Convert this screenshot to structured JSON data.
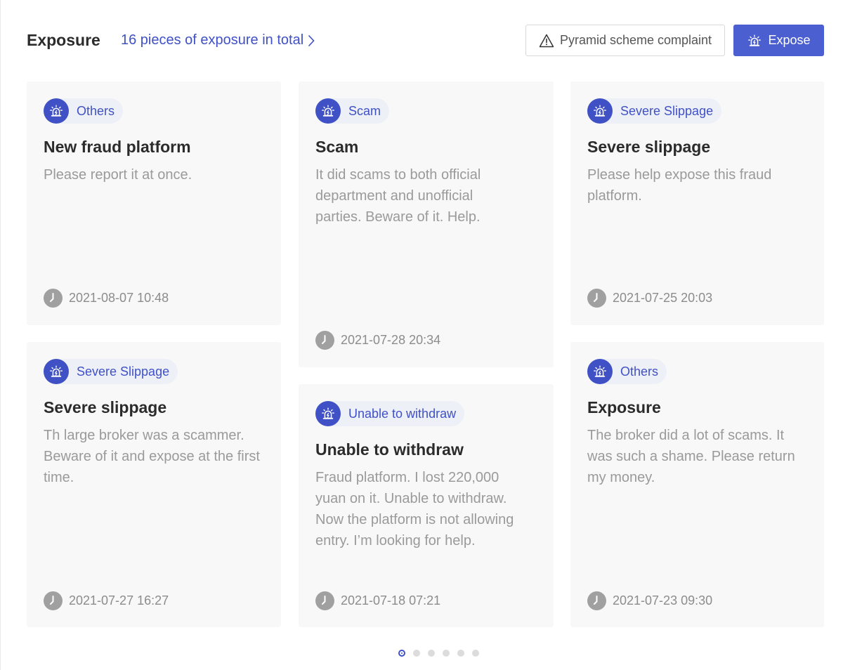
{
  "header": {
    "title": "Exposure",
    "total_link": "16 pieces of exposure in total",
    "complaint_button": "Pyramid scheme complaint",
    "expose_button": "Expose"
  },
  "colors": {
    "accent": "#3f51c5",
    "button": "#4b5fd1",
    "card_bg": "#f8f8f8"
  },
  "cards": [
    {
      "tag": "Others",
      "title": "New fraud platform",
      "body": "Please report it at once.",
      "time": "2021-08-07 10:48"
    },
    {
      "tag": "Scam",
      "title": "Scam",
      "body": "It did scams to both official department and unofficial parties. Beware of it. Help.",
      "time": "2021-07-28 20:34"
    },
    {
      "tag": "Severe Slippage",
      "title": "Severe slippage",
      "body": "Please help expose this fraud platform.",
      "time": "2021-07-25 20:03"
    },
    {
      "tag": "Severe Slippage",
      "title": "Severe slippage",
      "body": "Th large broker was a scammer. Beware of it and expose at the first time.",
      "time": "2021-07-27 16:27"
    },
    {
      "tag": "Unable to withdraw",
      "title": "Unable to withdraw",
      "body": "Fraud platform. I lost 220,000 yuan on it. Unable to withdraw. Now the platform is not allowing entry. I’m looking for help.",
      "time": "2021-07-18 07:21"
    },
    {
      "tag": "Others",
      "title": "Exposure",
      "body": "The broker did a lot of scams. It was such a shame. Please return my money.",
      "time": "2021-07-23 09:30"
    }
  ],
  "pagination": {
    "pages": 6,
    "current": 1
  },
  "icons": {
    "tag": "alarm-icon",
    "time": "clock-icon",
    "complaint": "warning-icon",
    "expose": "alarm-icon",
    "link": "chevron-right-icon"
  }
}
